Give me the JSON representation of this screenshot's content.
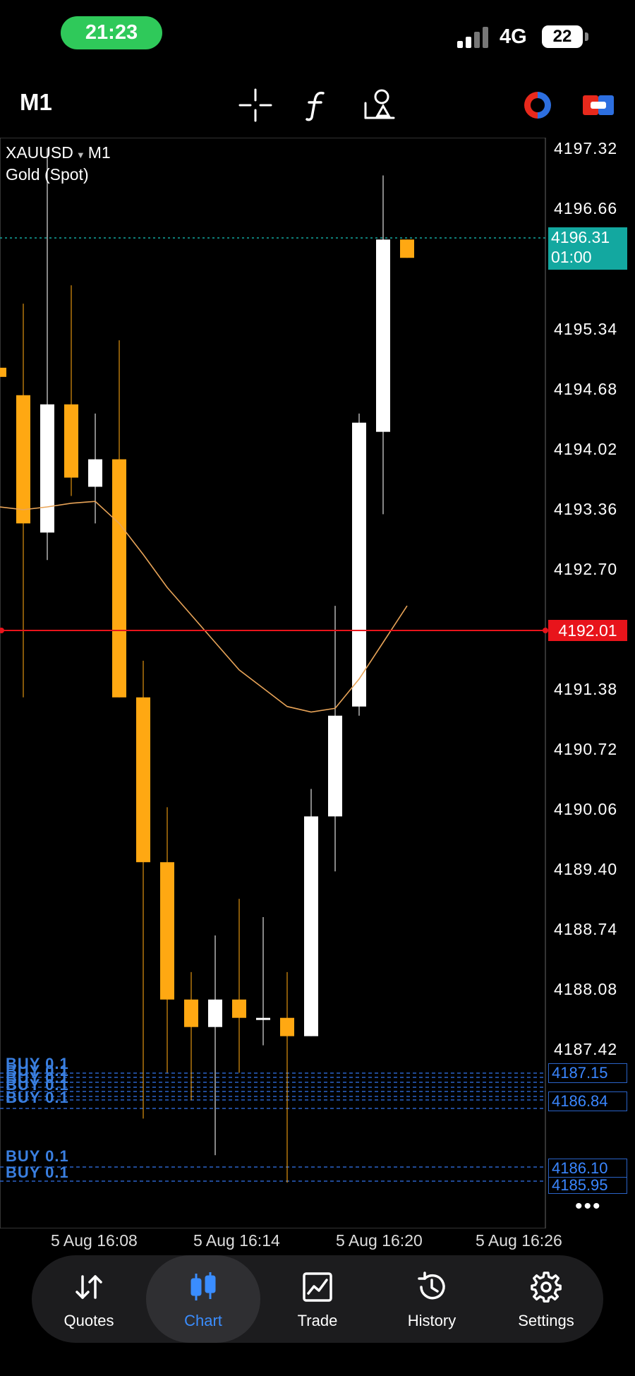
{
  "status_bar": {
    "time": "21:23",
    "network": "4G",
    "battery": "22"
  },
  "toolbar": {
    "timeframe": "M1"
  },
  "symbol": {
    "name": "XAUUSD",
    "arrow": "▼",
    "period": "M1",
    "description": "Gold (Spot)"
  },
  "price_axis": [
    "4197.32",
    "4196.66",
    "4195.34",
    "4194.68",
    "4194.02",
    "4193.36",
    "4192.70",
    "4191.38",
    "4190.72",
    "4190.06",
    "4189.40",
    "4188.74",
    "4188.08",
    "4187.42"
  ],
  "current_price": {
    "price": "4196.31",
    "countdown": "01:00"
  },
  "red_line_price": "4192.01",
  "order_prices": [
    "4187.15",
    "4186.84",
    "4186.10",
    "4185.95"
  ],
  "order_labels": [
    "BUY 0.1",
    "BUY 0.1",
    "BUY 0.1",
    "BUY 0.1",
    "BUY 0.1",
    "BUY 0.1",
    "BUY 0.1"
  ],
  "more_label": "•••",
  "time_axis": [
    "5 Aug 16:08",
    "5 Aug 16:14",
    "5 Aug 16:20",
    "5 Aug 16:26"
  ],
  "colors": {
    "bull": "#ffffff",
    "bear": "#ffa812",
    "ma": "#e8a458",
    "red_line": "#e8141b",
    "order_line": "#2a63c7",
    "accent": "#3a8dff"
  },
  "chart_data": {
    "type": "candlestick",
    "timeframe": "M1",
    "y_range": [
      4185.5,
      4197.6
    ],
    "candles": [
      {
        "open": 4194.9,
        "close": 4194.8,
        "high": 4195.0,
        "low": 4193.9
      },
      {
        "open": 4194.6,
        "close": 4193.2,
        "high": 4195.6,
        "low": 4191.3
      },
      {
        "open": 4193.1,
        "close": 4194.5,
        "high": 4197.3,
        "low": 4192.8
      },
      {
        "open": 4194.5,
        "close": 4193.7,
        "high": 4195.8,
        "low": 4193.5
      },
      {
        "open": 4193.6,
        "close": 4193.9,
        "high": 4194.4,
        "low": 4193.2
      },
      {
        "open": 4193.9,
        "close": 4191.3,
        "high": 4195.2,
        "low": 4191.3
      },
      {
        "open": 4191.3,
        "close": 4189.5,
        "high": 4191.7,
        "low": 4186.7
      },
      {
        "open": 4189.5,
        "close": 4188.0,
        "high": 4190.1,
        "low": 4187.2
      },
      {
        "open": 4188.0,
        "close": 4187.7,
        "high": 4188.3,
        "low": 4186.9
      },
      {
        "open": 4187.7,
        "close": 4188.0,
        "high": 4188.7,
        "low": 4186.3
      },
      {
        "open": 4188.0,
        "close": 4187.8,
        "high": 4189.1,
        "low": 4187.2
      },
      {
        "open": 4187.8,
        "close": 4187.8,
        "high": 4188.9,
        "low": 4187.5
      },
      {
        "open": 4187.8,
        "close": 4187.6,
        "high": 4188.3,
        "low": 4186.0
      },
      {
        "open": 4187.6,
        "close": 4190.0,
        "high": 4190.3,
        "low": 4187.6
      },
      {
        "open": 4190.0,
        "close": 4191.1,
        "high": 4192.3,
        "low": 4189.4
      },
      {
        "open": 4191.2,
        "close": 4194.3,
        "high": 4194.4,
        "low": 4191.1
      },
      {
        "open": 4194.2,
        "close": 4196.3,
        "high": 4197.0,
        "low": 4193.3
      },
      {
        "open": 4196.3,
        "close": 4196.1,
        "high": 4196.3,
        "low": 4196.1
      }
    ],
    "moving_average": [
      4193.38,
      4193.35,
      4193.38,
      4193.42,
      4193.44,
      4193.2,
      4192.86,
      4192.5,
      4192.2,
      4191.9,
      4191.6,
      4191.4,
      4191.2,
      4191.14,
      4191.18,
      4191.5,
      4191.9,
      4192.3
    ]
  },
  "nav": [
    {
      "label": "Quotes",
      "icon": "quotes-arrows-icon"
    },
    {
      "label": "Chart",
      "icon": "candlestick-icon"
    },
    {
      "label": "Trade",
      "icon": "trade-chart-icon"
    },
    {
      "label": "History",
      "icon": "history-clock-icon"
    },
    {
      "label": "Settings",
      "icon": "gear-icon"
    }
  ]
}
